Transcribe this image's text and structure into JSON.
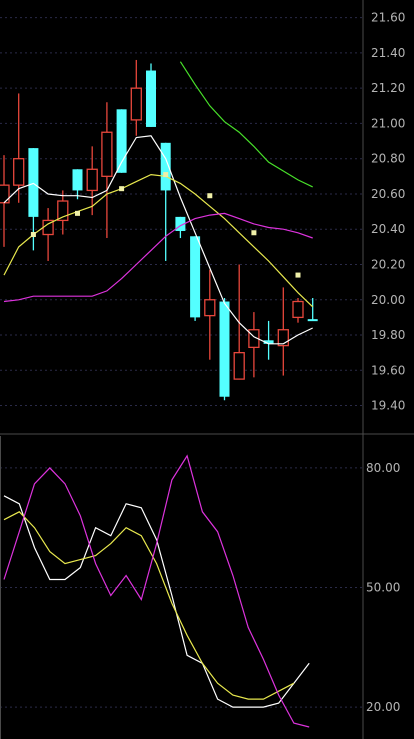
{
  "colors": {
    "background": "#000000",
    "grid": "#2a2a48",
    "axis": "#4a4a4a",
    "up_candle": "#e8473c",
    "down_candle": "#54ffff",
    "ma_white": "#ffffff",
    "ma_yellow": "#e8e84e",
    "ma_magenta": "#dd33dd",
    "ma_green": "#48e02a",
    "tick_text": "#b4b4b4"
  },
  "chart_data": [
    {
      "type": "candlestick",
      "title": "",
      "ylim": [
        19.25,
        21.7
      ],
      "grid": true,
      "y_ticks": [
        "21.60",
        "21.40",
        "21.20",
        "21.00",
        "20.80",
        "20.60",
        "20.40",
        "20.20",
        "20.00",
        "19.80",
        "19.60",
        "19.40"
      ],
      "candles": [
        {
          "open": 20.55,
          "close": 20.65,
          "high": 20.82,
          "low": 20.3,
          "dir": "up"
        },
        {
          "open": 20.65,
          "close": 20.8,
          "high": 21.17,
          "low": 20.55,
          "dir": "up"
        },
        {
          "open": 20.86,
          "close": 20.47,
          "high": 20.86,
          "low": 20.28,
          "dir": "down"
        },
        {
          "open": 20.37,
          "close": 20.45,
          "high": 20.52,
          "low": 20.22,
          "dir": "up"
        },
        {
          "open": 20.45,
          "close": 20.56,
          "high": 20.62,
          "low": 20.37,
          "dir": "up"
        },
        {
          "open": 20.74,
          "close": 20.62,
          "high": 20.74,
          "low": 20.57,
          "dir": "down"
        },
        {
          "open": 20.62,
          "close": 20.74,
          "high": 20.87,
          "low": 20.48,
          "dir": "up"
        },
        {
          "open": 20.7,
          "close": 20.95,
          "high": 21.12,
          "low": 20.35,
          "dir": "up"
        },
        {
          "open": 21.08,
          "close": 20.72,
          "high": 21.08,
          "low": 20.72,
          "dir": "down"
        },
        {
          "open": 21.02,
          "close": 21.2,
          "high": 21.36,
          "low": 20.93,
          "dir": "up"
        },
        {
          "open": 21.3,
          "close": 20.98,
          "high": 21.34,
          "low": 20.98,
          "dir": "down"
        },
        {
          "open": 20.89,
          "close": 20.62,
          "high": 20.89,
          "low": 20.22,
          "dir": "down"
        },
        {
          "open": 20.47,
          "close": 20.39,
          "high": 20.47,
          "low": 20.35,
          "dir": "down"
        },
        {
          "open": 20.36,
          "close": 19.9,
          "high": 20.36,
          "low": 19.88,
          "dir": "down"
        },
        {
          "open": 19.91,
          "close": 20.0,
          "high": 20.17,
          "low": 19.66,
          "dir": "up"
        },
        {
          "open": 19.99,
          "close": 19.45,
          "high": 20.01,
          "low": 19.43,
          "dir": "down"
        },
        {
          "open": 19.55,
          "close": 19.7,
          "high": 20.2,
          "low": 19.55,
          "dir": "up"
        },
        {
          "open": 19.73,
          "close": 19.83,
          "high": 19.93,
          "low": 19.56,
          "dir": "up"
        },
        {
          "open": 19.77,
          "close": 19.75,
          "high": 19.88,
          "low": 19.66,
          "dir": "down"
        },
        {
          "open": 19.74,
          "close": 19.83,
          "high": 20.07,
          "low": 19.57,
          "dir": "up"
        },
        {
          "open": 19.9,
          "close": 19.99,
          "high": 20.01,
          "low": 19.87,
          "dir": "up"
        },
        {
          "open": 19.89,
          "close": 19.89,
          "high": 20.01,
          "low": 19.88,
          "dir": "down"
        }
      ],
      "series": [
        {
          "color": "#ffffff",
          "values": [
            20.55,
            20.63,
            20.66,
            20.6,
            20.59,
            20.59,
            20.58,
            20.62,
            20.78,
            20.92,
            20.93,
            20.8,
            20.58,
            20.38,
            20.18,
            19.98,
            19.87,
            19.79,
            19.75,
            19.75,
            19.8,
            19.84
          ]
        },
        {
          "color": "#e8e84e",
          "values": [
            20.14,
            20.3,
            20.37,
            20.43,
            20.47,
            20.5,
            20.53,
            20.6,
            20.63,
            20.67,
            20.71,
            20.7,
            20.66,
            20.6,
            20.53,
            20.46,
            20.38,
            20.3,
            20.22,
            20.13,
            20.04,
            19.96
          ]
        },
        {
          "color": "#dd33dd",
          "values": [
            19.99,
            20.0,
            20.02,
            20.02,
            20.02,
            20.02,
            20.02,
            20.05,
            20.12,
            20.2,
            20.28,
            20.36,
            20.42,
            20.46,
            20.48,
            20.49,
            20.46,
            20.43,
            20.41,
            20.4,
            20.38,
            20.35
          ]
        },
        {
          "color": "#48e02a",
          "values": [
            null,
            null,
            null,
            null,
            null,
            null,
            null,
            null,
            null,
            null,
            null,
            null,
            21.35,
            21.22,
            21.1,
            21.01,
            20.95,
            20.87,
            20.78,
            20.73,
            20.68,
            20.64
          ]
        }
      ],
      "markers": [
        {
          "index": 2,
          "value": 20.37
        },
        {
          "index": 5,
          "value": 20.49
        },
        {
          "index": 8,
          "value": 20.63
        },
        {
          "index": 11,
          "value": 20.71
        },
        {
          "index": 14,
          "value": 20.59
        },
        {
          "index": 17,
          "value": 20.38
        },
        {
          "index": 20,
          "value": 20.14
        }
      ]
    },
    {
      "type": "line",
      "title": "",
      "ylim": [
        12.0,
        88.0
      ],
      "grid": true,
      "y_ticks": [
        "80.00",
        "50.00",
        "20.00"
      ],
      "series": [
        {
          "color": "#ffffff",
          "values": [
            73,
            71,
            60,
            52,
            52,
            55,
            65,
            63,
            71,
            70,
            62,
            48,
            33,
            31,
            22,
            20,
            20,
            20,
            21,
            26,
            31
          ]
        },
        {
          "color": "#e8e84e",
          "values": [
            67,
            69,
            65,
            59,
            56,
            57,
            58,
            61,
            65,
            63,
            56,
            46,
            38,
            31,
            26,
            23,
            22,
            22,
            24,
            26
          ]
        },
        {
          "color": "#dd33dd",
          "values": [
            52,
            64,
            76,
            80,
            76,
            68,
            56,
            48,
            53,
            47,
            61,
            77,
            83,
            69,
            64,
            53,
            40,
            32,
            23,
            16,
            15
          ]
        }
      ]
    }
  ]
}
